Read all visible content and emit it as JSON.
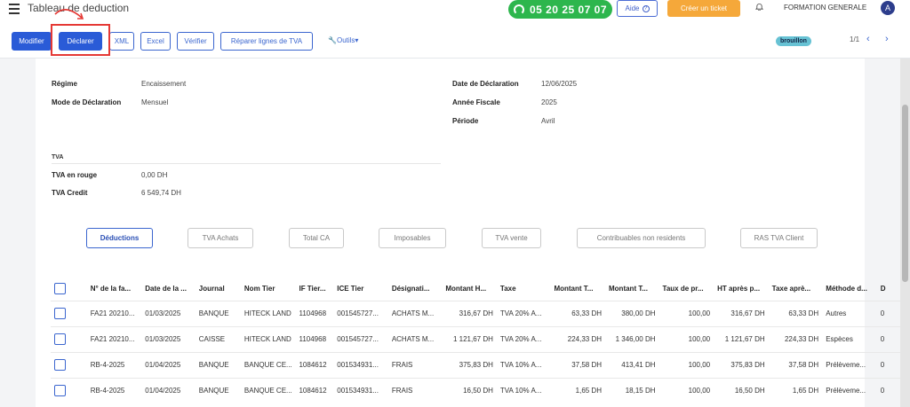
{
  "header": {
    "title": "Tableau de deduction",
    "phone": "05 20 25 07 07",
    "help_label": "Aide",
    "ticket_label": "Créer un ticket",
    "company": "FORMATION GENERALE",
    "avatar_initial": "A"
  },
  "toolbar": {
    "modifier": "Modifier",
    "declarer": "Déclarer",
    "xml": "XML",
    "excel": "Excel",
    "verifier": "Vérifier",
    "reparer": "Réparer lignes de TVA",
    "outils": "Outils",
    "status": "brouillon",
    "pager": "1/1"
  },
  "info": {
    "regime_label": "Régime",
    "regime_value": "Encaissement",
    "mode_label": "Mode de Déclaration",
    "mode_value": "Mensuel",
    "date_label": "Date de Déclaration",
    "date_value": "12/06/2025",
    "annee_label": "Année Fiscale",
    "annee_value": "2025",
    "periode_label": "Période",
    "periode_value": "Avril"
  },
  "tva": {
    "section": "TVA",
    "rouge_label": "TVA en rouge",
    "rouge_value": "0,00 DH",
    "credit_label": "TVA Credit",
    "credit_value": "6 549,74 DH"
  },
  "tabs": [
    "Déductions",
    "TVA Achats",
    "Total CA",
    "Imposables",
    "TVA vente",
    "Contribuables non residents",
    "RAS TVA Client"
  ],
  "table": {
    "columns": [
      "N° de la fa...",
      "Date de la ...",
      "Journal",
      "Nom Tier",
      "IF Tier...",
      "ICE Tier",
      "Désignati...",
      "Montant H...",
      "Taxe",
      "Montant T...",
      "Montant T...",
      "Taux de pr...",
      "HT après p...",
      "Taxe aprè...",
      "Méthode d...",
      "D"
    ],
    "rows": [
      [
        "FA21 20210...",
        "01/03/2025",
        "BANQUE",
        "HITECK LAND",
        "1104968",
        "001545727...",
        "ACHATS M...",
        "316,67 DH",
        "TVA 20% A...",
        "63,33 DH",
        "380,00 DH",
        "100,00",
        "316,67 DH",
        "63,33 DH",
        "Autres",
        "0"
      ],
      [
        "FA21 20210...",
        "01/03/2025",
        "CAISSE",
        "HITECK LAND",
        "1104968",
        "001545727...",
        "ACHATS M...",
        "1 121,67 DH",
        "TVA 20% A...",
        "224,33 DH",
        "1 346,00 DH",
        "100,00",
        "1 121,67 DH",
        "224,33 DH",
        "Espèces",
        "0"
      ],
      [
        "RB-4-2025",
        "01/04/2025",
        "BANQUE",
        "BANQUE CE...",
        "1084612",
        "001534931...",
        "FRAIS",
        "375,83 DH",
        "TVA 10% A...",
        "37,58 DH",
        "413,41 DH",
        "100,00",
        "375,83 DH",
        "37,58 DH",
        "Prélèveme...",
        "0"
      ],
      [
        "RB-4-2025",
        "01/04/2025",
        "BANQUE",
        "BANQUE CE...",
        "1084612",
        "001534931...",
        "FRAIS",
        "16,50 DH",
        "TVA 10% A...",
        "1,65 DH",
        "18,15 DH",
        "100,00",
        "16,50 DH",
        "1,65 DH",
        "Prélèveme...",
        "0"
      ]
    ]
  }
}
